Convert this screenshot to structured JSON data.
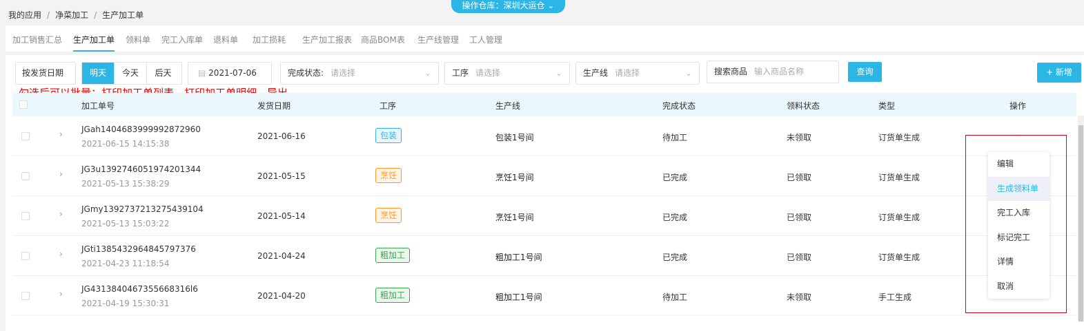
{
  "breadcrumb": [
    "我的应用",
    "净菜加工",
    "生产加工单"
  ],
  "warehouse": {
    "label": "操作仓库：",
    "value": "深圳大运仓"
  },
  "tabs": [
    {
      "label": "加工销售汇总"
    },
    {
      "label": "生产加工单",
      "active": true
    },
    {
      "label": "领料单"
    },
    {
      "label": "完工入库单"
    },
    {
      "label": "退料单"
    },
    {
      "label": "加工损耗"
    },
    {
      "label": "生产加工报表"
    },
    {
      "label": "商品BOM表"
    },
    {
      "label": "生产线管理"
    },
    {
      "label": "工人管理"
    }
  ],
  "filters": {
    "date_type": "按发货日期",
    "quick_dates": [
      "明天",
      "今天",
      "后天"
    ],
    "active_quick": "明天",
    "date": "2021-07-06",
    "status_label": "完成状态:",
    "status_placeholder": "请选择",
    "process_label": "工序",
    "process_placeholder": "请选择",
    "line_label": "生产线",
    "line_placeholder": "请选择",
    "search_label": "搜索商品",
    "search_placeholder": "输入商品名称",
    "query_button": "查询",
    "add_button": "+ 新增"
  },
  "annotation": "勾选后可以批量：打印加工单列表、打印加工单明细、导出",
  "table": {
    "headers": [
      "加工单号",
      "发货日期",
      "工序",
      "生产线",
      "完成状态",
      "领料状态",
      "类型",
      "操作"
    ],
    "rows": [
      {
        "id": "JGah1404683999992872960",
        "created": "2021-06-15 14:15:38",
        "date": "2021-06-16",
        "process": "包装",
        "process_color": "blue",
        "line": "包装1号间",
        "status": "待加工",
        "material": "未领取",
        "type": "订货单生成"
      },
      {
        "id": "JG3u1392746051974201344",
        "created": "2021-05-13 15:38:29",
        "date": "2021-05-15",
        "process": "烹饪",
        "process_color": "orange",
        "line": "烹饪1号间",
        "status": "已完成",
        "material": "已领取",
        "type": "订货单生成"
      },
      {
        "id": "JGmy1392737213275439104",
        "created": "2021-05-13 15:03:22",
        "date": "2021-05-14",
        "process": "烹饪",
        "process_color": "orange",
        "line": "烹饪1号间",
        "status": "已完成",
        "material": "已领取",
        "type": "订货单生成"
      },
      {
        "id": "JGti1385432964845797376",
        "created": "2021-04-23 11:18:54",
        "date": "2021-04-24",
        "process": "粗加工",
        "process_color": "green",
        "line": "粗加工1号间",
        "status": "已完成",
        "material": "已领取",
        "type": "订货单生成"
      },
      {
        "id": "JG4313840467355668316l6",
        "created": "2021-04-19 15:30:31",
        "date": "2021-04-20",
        "process": "粗加工",
        "process_color": "green",
        "line": "粗加工1号间",
        "status": "待加工",
        "material": "未领取",
        "type": "手工生成"
      }
    ]
  },
  "ops_menu": {
    "trigger": "···",
    "items": [
      "编辑",
      "生成领料单",
      "完工入库",
      "标记完工",
      "详情",
      "取消"
    ],
    "highlighted": "生成领料单"
  },
  "colors": {
    "accent": "#2bb6e6",
    "annotation": "#e00000",
    "blue": "#2bb6e6",
    "orange": "#ff9a1f",
    "green": "#3aa84b"
  }
}
